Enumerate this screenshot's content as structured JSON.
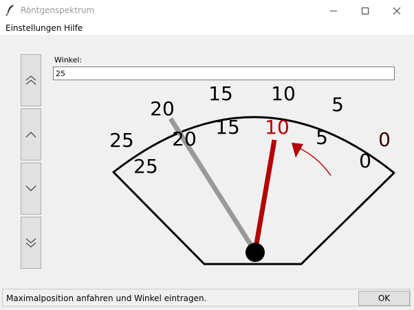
{
  "window": {
    "title": "Röntgenspektrum",
    "icon": "feather-icon",
    "controls": [
      "minimize-icon",
      "maximize-icon",
      "close-icon"
    ]
  },
  "menu": {
    "items": [
      {
        "label": "Einstellungen"
      },
      {
        "label": "Hilfe"
      }
    ]
  },
  "side_buttons": [
    {
      "icon": "double-chevron-up-icon"
    },
    {
      "icon": "chevron-up-icon"
    },
    {
      "icon": "chevron-down-icon"
    },
    {
      "icon": "double-chevron-down-icon"
    }
  ],
  "angle_field": {
    "label": "Winkel:",
    "value": "25"
  },
  "gauge": {
    "outer_scale": [
      "25",
      "20",
      "15",
      "10",
      "5",
      "0"
    ],
    "inner_scale": [
      "25",
      "20",
      "15",
      "10",
      "5",
      "0"
    ],
    "highlight_label": "10",
    "colors": {
      "needle_red": "#b30000",
      "needle_gray": "#999999",
      "label_dark_red": "#3a0000"
    }
  },
  "status_bar": {
    "message": "Maximalposition anfahren und Winkel eintragen.",
    "ok_label": "OK"
  }
}
